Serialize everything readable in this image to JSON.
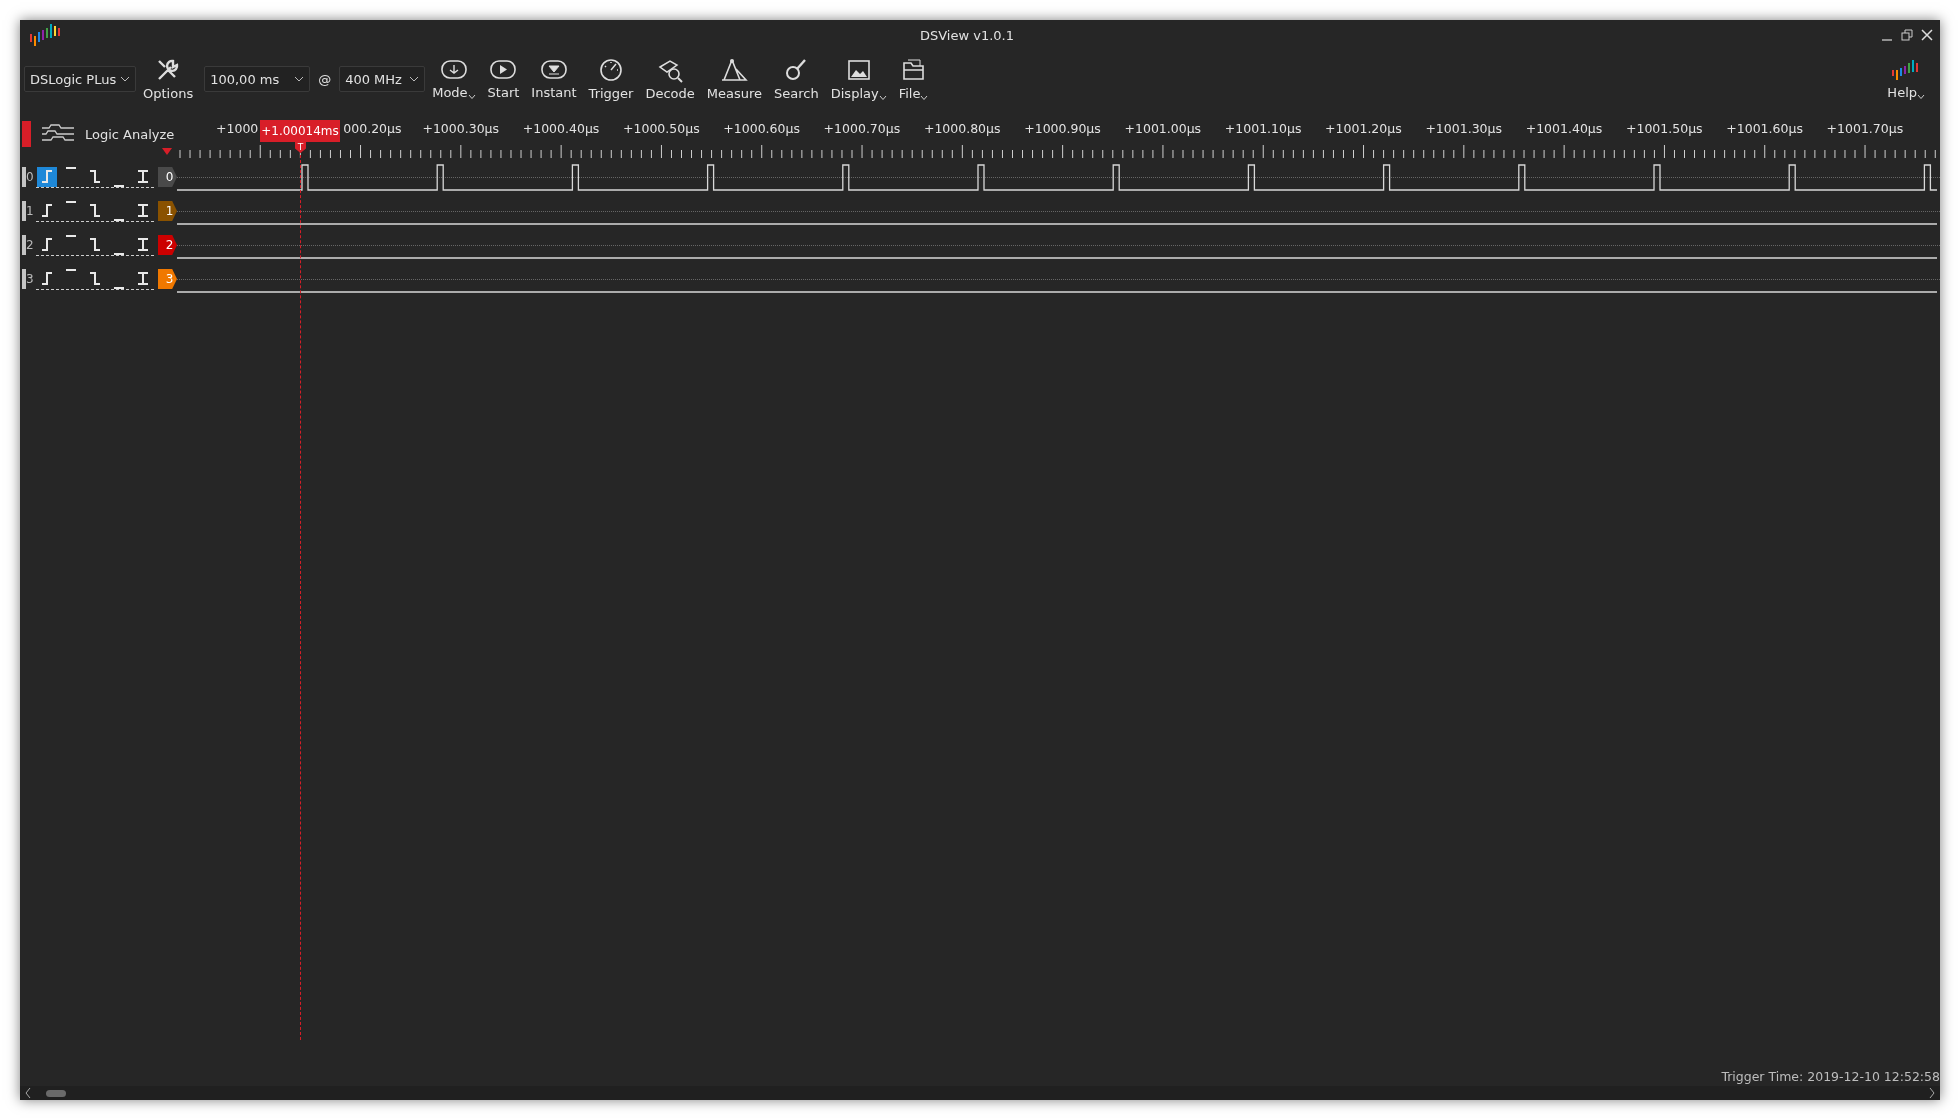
{
  "window": {
    "title": "DSView v1.0.1"
  },
  "toolbar": {
    "device": {
      "value": "DSLogic PLus"
    },
    "options": {
      "label": "Options"
    },
    "duration": {
      "value": "100,00 ms"
    },
    "at": "@",
    "rate": {
      "value": "400 MHz"
    },
    "buttons": [
      {
        "kind": "mode",
        "label": "Mode",
        "dropdown": true
      },
      {
        "kind": "start",
        "label": "Start",
        "dropdown": false
      },
      {
        "kind": "instant",
        "label": "Instant",
        "dropdown": false
      },
      {
        "kind": "trigger",
        "label": "Trigger",
        "dropdown": false
      },
      {
        "kind": "decode",
        "label": "Decode",
        "dropdown": false
      },
      {
        "kind": "measure",
        "label": "Measure",
        "dropdown": false
      },
      {
        "kind": "search",
        "label": "Search",
        "dropdown": false
      },
      {
        "kind": "display",
        "label": "Display",
        "dropdown": true
      },
      {
        "kind": "file",
        "label": "File",
        "dropdown": true
      }
    ],
    "help": {
      "label": "Help",
      "dropdown": true
    }
  },
  "header": {
    "title": "Logic Analyze"
  },
  "ruler": {
    "labels": [
      {
        "text": "+1000",
        "kind": "cut_right"
      },
      {
        "text": "000.20µs",
        "kind": "cut_left"
      },
      {
        "text": "+1000.30µs",
        "kind": "full"
      },
      {
        "text": "+1000.40µs",
        "kind": "full"
      },
      {
        "text": "+1000.50µs",
        "kind": "full"
      },
      {
        "text": "+1000.60µs",
        "kind": "full"
      },
      {
        "text": "+1000.70µs",
        "kind": "full"
      },
      {
        "text": "+1000.80µs",
        "kind": "full"
      },
      {
        "text": "+1000.90µs",
        "kind": "full"
      },
      {
        "text": "+1001.00µs",
        "kind": "full"
      },
      {
        "text": "+1001.10µs",
        "kind": "full"
      },
      {
        "text": "+1001.20µs",
        "kind": "full"
      },
      {
        "text": "+1001.30µs",
        "kind": "full"
      },
      {
        "text": "+1001.40µs",
        "kind": "full"
      },
      {
        "text": "+1001.50µs",
        "kind": "full"
      },
      {
        "text": "+1001.60µs",
        "kind": "full"
      },
      {
        "text": "+1001.70µs",
        "kind": "full"
      }
    ],
    "cursor": {
      "label": "+1.00014ms",
      "flag": "T"
    }
  },
  "channels": [
    {
      "index": "0",
      "tag": "0",
      "color": "#4a4a4a",
      "kind": "pulses",
      "triggers": [
        {
          "kind": "rise",
          "selected": true
        },
        {
          "kind": "high",
          "selected": false
        },
        {
          "kind": "fall",
          "selected": false
        },
        {
          "kind": "low",
          "selected": false
        },
        {
          "kind": "any",
          "selected": false
        }
      ]
    },
    {
      "index": "1",
      "tag": "1",
      "color": "#8a5200",
      "kind": "low",
      "triggers": [
        {
          "kind": "rise",
          "selected": false
        },
        {
          "kind": "high",
          "selected": false
        },
        {
          "kind": "fall",
          "selected": false
        },
        {
          "kind": "low",
          "selected": false
        },
        {
          "kind": "any",
          "selected": false
        }
      ]
    },
    {
      "index": "2",
      "tag": "2",
      "color": "#cc0000",
      "kind": "low",
      "triggers": [
        {
          "kind": "rise",
          "selected": false
        },
        {
          "kind": "high",
          "selected": false
        },
        {
          "kind": "fall",
          "selected": false
        },
        {
          "kind": "low",
          "selected": false
        },
        {
          "kind": "any",
          "selected": false
        }
      ]
    },
    {
      "index": "3",
      "tag": "3",
      "color": "#f07800",
      "kind": "low",
      "triggers": [
        {
          "kind": "rise",
          "selected": false
        },
        {
          "kind": "high",
          "selected": false
        },
        {
          "kind": "fall",
          "selected": false
        },
        {
          "kind": "low",
          "selected": false
        },
        {
          "kind": "any",
          "selected": false
        }
      ]
    }
  ],
  "status": {
    "trigger_time": "Trigger Time: 2019-12-10 12:52:58"
  }
}
